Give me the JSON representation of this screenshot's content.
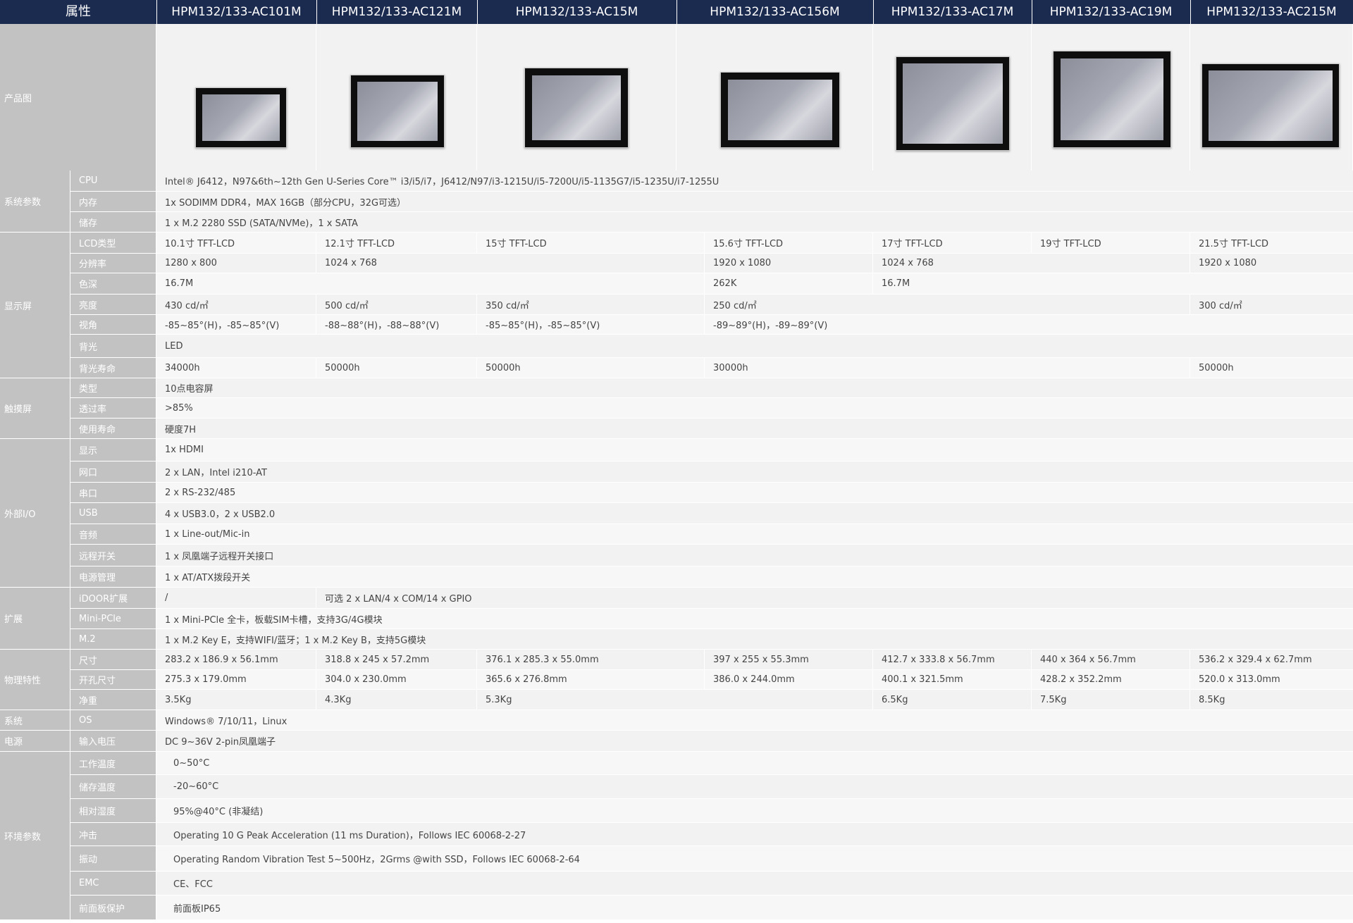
{
  "header": {
    "attr_label": "属性",
    "models": [
      "HPM132/133-AC101M",
      "HPM132/133-AC121M",
      "HPM132/133-AC15M",
      "HPM132/133-AC156M",
      "HPM132/133-AC17M",
      "HPM132/133-AC19M",
      "HPM132/133-AC215M"
    ]
  },
  "product_image_label": "产品图",
  "groups": [
    "系统参数",
    "显示屏",
    "触摸屏",
    "外部I/O",
    "扩展",
    "物理特性",
    "系统",
    "电源",
    "环境参数"
  ],
  "rows": [
    {
      "label": "CPU",
      "cells": [
        "Intel® J6412，N97&6th~12th Gen U-Series Core™ i3/i5/i7，J6412/N97/i3-1215U/i5-7200U/i5-1135G7/i5-1235U/i7-1255U"
      ]
    },
    {
      "label": "内存",
      "cells": [
        "1x SODIMM DDR4，MAX 16GB（部分CPU，32G可选）"
      ]
    },
    {
      "label": "储存",
      "cells": [
        "1 x M.2 2280 SSD (SATA/NVMe)，1 x SATA"
      ]
    },
    {
      "label": "LCD类型",
      "cells": [
        "10.1寸 TFT-LCD",
        "12.1寸 TFT-LCD",
        "15寸 TFT-LCD",
        "15.6寸 TFT-LCD",
        "17寸 TFT-LCD",
        "19寸 TFT-LCD",
        "21.5寸 TFT-LCD"
      ]
    },
    {
      "label": "分辨率",
      "cells": [
        "1280 x 800",
        "1024 x 768",
        "1920 x 1080",
        "1024 x 768",
        "1920 x 1080"
      ]
    },
    {
      "label": "色深",
      "cells": [
        "16.7M",
        "262K",
        "16.7M"
      ]
    },
    {
      "label": "亮度",
      "cells": [
        "430 cd/㎡",
        "500 cd/㎡",
        "350 cd/㎡",
        "250 cd/㎡",
        "300 cd/㎡"
      ]
    },
    {
      "label": "视角",
      "cells": [
        "-85~85°(H)，-85~85°(V)",
        "-88~88°(H)，-88~88°(V)",
        "-85~85°(H)，-85~85°(V)",
        "-89~89°(H)，-89~89°(V)"
      ]
    },
    {
      "label": "背光",
      "cells": [
        "LED"
      ]
    },
    {
      "label": "背光寿命",
      "cells": [
        "34000h",
        "50000h",
        "50000h",
        "30000h",
        "50000h"
      ]
    },
    {
      "label": "类型",
      "cells": [
        "10点电容屏"
      ]
    },
    {
      "label": "透过率",
      "cells": [
        ">85%"
      ]
    },
    {
      "label": "使用寿命",
      "cells": [
        "硬度7H"
      ]
    },
    {
      "label": "显示",
      "cells": [
        "1x HDMI"
      ]
    },
    {
      "label": "网口",
      "cells": [
        "2 x LAN，Intel i210-AT"
      ]
    },
    {
      "label": "串口",
      "cells": [
        "2 x RS-232/485"
      ]
    },
    {
      "label": "USB",
      "cells": [
        "4 x USB3.0，2 x USB2.0"
      ]
    },
    {
      "label": "音频",
      "cells": [
        "1 x Line-out/Mic-in"
      ]
    },
    {
      "label": "远程开关",
      "cells": [
        "1 x 凤凰端子远程开关接口"
      ]
    },
    {
      "label": "电源管理",
      "cells": [
        "1 x AT/ATX拨段开关"
      ]
    },
    {
      "label": "iDOOR扩展",
      "cells": [
        "/",
        "可选 2 x LAN/4 x COM/14 x GPIO"
      ]
    },
    {
      "label": "Mini-PCle",
      "cells": [
        "1 x Mini-PCle 全卡，板载SIM卡槽，支持3G/4G模块"
      ]
    },
    {
      "label": "M.2",
      "cells": [
        "1 x M.2 Key E，支持WIFI/蓝牙；1 x M.2 Key B，支持5G模块"
      ]
    },
    {
      "label": "尺寸",
      "cells": [
        "283.2 x 186.9 x 56.1mm",
        "318.8 x 245 x 57.2mm",
        "376.1 x 285.3 x 55.0mm",
        "397 x 255 x 55.3mm",
        "412.7 x 333.8 x 56.7mm",
        "440 x 364 x 56.7mm",
        "536.2 x 329.4 x 62.7mm"
      ]
    },
    {
      "label": "开孔尺寸",
      "cells": [
        "275.3 x 179.0mm",
        "304.0 x 230.0mm",
        "365.6 x 276.8mm",
        "386.0 x 244.0mm",
        "400.1 x 321.5mm",
        "428.2 x 352.2mm",
        "520.0 x 313.0mm"
      ]
    },
    {
      "label": "净重",
      "cells": [
        "3.5Kg",
        "4.3Kg",
        "5.3Kg",
        "6.5Kg",
        "7.5Kg",
        "8.5Kg"
      ]
    },
    {
      "label": "OS",
      "cells": [
        "Windows® 7/10/11，Linux"
      ]
    },
    {
      "label": "输入电压",
      "cells": [
        "DC 9~36V 2-pin凤凰端子"
      ]
    },
    {
      "label": "工作温度",
      "cells": [
        "0~50°C"
      ]
    },
    {
      "label": "储存温度",
      "cells": [
        "-20~60°C"
      ]
    },
    {
      "label": "相对湿度",
      "cells": [
        "95%@40°C (非凝结)"
      ]
    },
    {
      "label": "冲击",
      "cells": [
        "Operating 10 G Peak Acceleration (11 ms Duration)，Follows IEC 60068-2-27"
      ]
    },
    {
      "label": "振动",
      "cells": [
        "Operating Random Vibration Test 5~500Hz，2Grms @with SSD，Follows IEC 60068-2-64"
      ]
    },
    {
      "label": "EMC",
      "cells": [
        "CE、FCC"
      ]
    },
    {
      "label": "前面板保护",
      "cells": [
        "前面板IP65"
      ]
    }
  ]
}
